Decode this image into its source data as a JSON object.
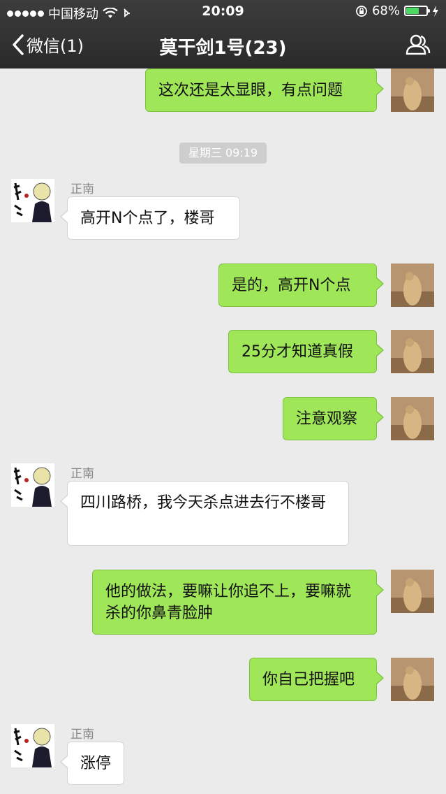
{
  "status_bar": {
    "carrier": "中国移动",
    "time": "20:09",
    "battery_percent": "68%",
    "battery_level": 0.68,
    "battery_color": "#4cd964"
  },
  "nav": {
    "back_label": "微信(1)",
    "title": "莫干剑1号(23)",
    "back_icon": "chevron-left-icon",
    "right_icon": "contacts-icon"
  },
  "colors": {
    "my_bubble": "#9fe658",
    "other_bubble": "#ffffff",
    "background": "#ebebeb",
    "nav_bar": "#2e2e2e"
  },
  "timestamp": "星期三 09:19",
  "messages": [
    {
      "from": "me",
      "text": "这次还是太显眼，有点问题"
    },
    {
      "from": "other",
      "sender": "正南",
      "text": "高开N个点了，楼哥"
    },
    {
      "from": "me",
      "text": "是的，高开N个点"
    },
    {
      "from": "me",
      "text": "25分才知道真假"
    },
    {
      "from": "me",
      "text": "注意观察"
    },
    {
      "from": "other",
      "sender": "正南",
      "text": "四川路桥，我今天杀点进去行不楼哥"
    },
    {
      "from": "me",
      "text": "他的做法，要嘛让你追不上，要嘛就杀的你鼻青脸肿"
    },
    {
      "from": "me",
      "text": "你自己把握吧"
    },
    {
      "from": "other",
      "sender": "正南",
      "text": "涨停"
    }
  ]
}
